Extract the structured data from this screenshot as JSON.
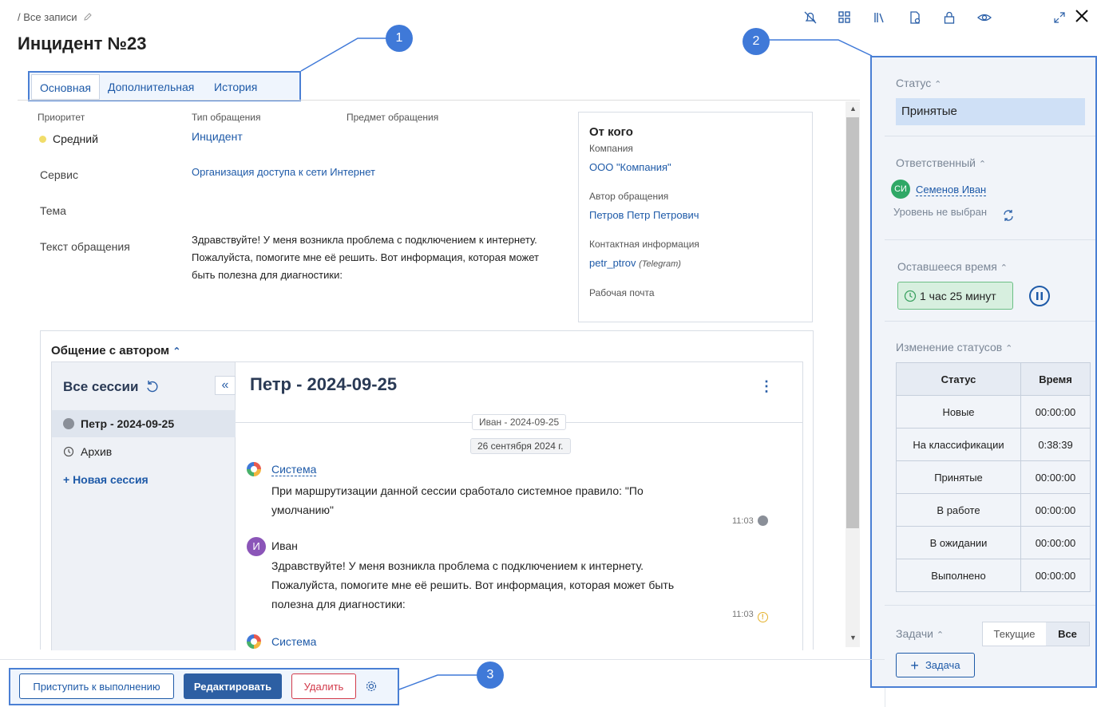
{
  "breadcrumb": "/ Все записи",
  "title": "Инцидент №23",
  "tabs": [
    "Основная",
    "Дополнительная",
    "История"
  ],
  "fields": {
    "priority_label": "Приоритет",
    "priority_value": "Средний",
    "type_label": "Тип обращения",
    "type_value": "Инцидент",
    "subject_label": "Предмет обращения",
    "service_label": "Сервис",
    "service_value": "Организация доступа к сети Интернет",
    "topic_label": "Тема",
    "text_label": "Текст обращения",
    "text_value_1": "Здравствуйте! У меня возникла проблема с подключением к интернету.",
    "text_value_2": "Пожалуйста, помогите мне её решить. Вот информация, которая может",
    "text_value_3": "быть полезна для диагностики:"
  },
  "from": {
    "title": "От кого",
    "company_label": "Компания",
    "company_value": "ООО \"Компания\"",
    "author_label": "Автор обращения",
    "author_value": "Петров Петр Петрович",
    "contact_label": "Контактная информация",
    "contact_value": "petr_ptrov",
    "contact_channel": "(Telegram)",
    "email_label": "Рабочая почта"
  },
  "chat": {
    "section_title": "Общение с автором",
    "sessions_title": "Все сессии",
    "sessions": [
      "Петр - 2024-09-25",
      "Архив",
      "+ Новая сессия"
    ],
    "session_title": "Петр - 2024-09-25",
    "divider_1": "Иван - 2024-09-25",
    "divider_2": "26 сентября 2024 г.",
    "messages": [
      {
        "author": "Система",
        "line1": "При маршрутизации данной сессии сработало системное правило: \"По",
        "line2": "умолчанию\"",
        "time": "11:03"
      },
      {
        "author": "Иван",
        "avatar": "И",
        "line1": "Здравствуйте! У меня возникла проблема с подключением к интернету.",
        "line2": "Пожалуйста, помогите мне её решить. Вот информация, которая может быть",
        "line3": "полезна для диагностики:",
        "time": "11:03"
      },
      {
        "author": "Система"
      }
    ]
  },
  "side": {
    "status_title": "Статус",
    "status_value": "Принятые",
    "resp_title": "Ответственный",
    "resp_avatar": "СИ",
    "resp_name": "Семенов Иван",
    "resp_level": "Уровень не выбран",
    "time_title": "Оставшееся время",
    "time_value": "1 час 25 минут",
    "changes_title": "Изменение статусов",
    "table_head": [
      "Статус",
      "Время"
    ],
    "table_rows": [
      [
        "Новые",
        "00:00:00"
      ],
      [
        "На классификации",
        "0:38:39"
      ],
      [
        "Принятые",
        "00:00:00"
      ],
      [
        "В работе",
        "00:00:00"
      ],
      [
        "В ожидании",
        "00:00:00"
      ],
      [
        "Выполнено",
        "00:00:00"
      ]
    ],
    "tasks_title": "Задачи",
    "tasks_current": "Текущие",
    "tasks_all": "Все",
    "add_task": "Задача"
  },
  "footer": {
    "start": "Приступить к выполнению",
    "edit": "Редактировать",
    "delete": "Удалить"
  },
  "callouts": [
    "1",
    "2",
    "3"
  ],
  "colors": {
    "accent": "#1e5aa8",
    "highlight_border": "#4a7fd4",
    "delete_red": "#d23a4a"
  }
}
